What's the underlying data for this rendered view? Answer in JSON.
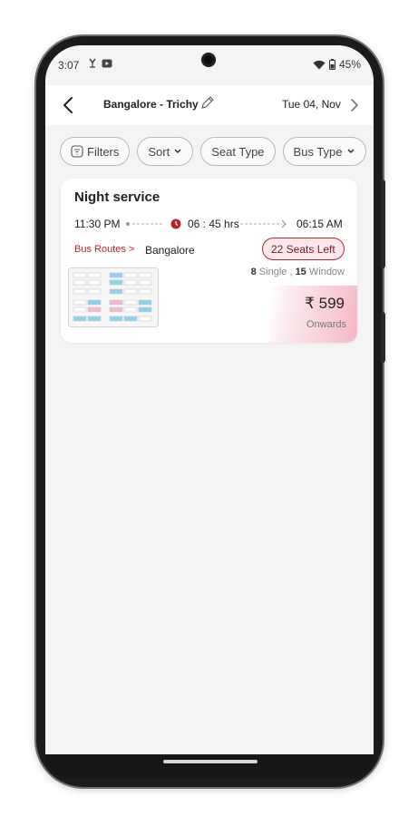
{
  "status_bar": {
    "time": "3:07",
    "battery": "45%"
  },
  "header": {
    "route": "Bangalore - Trichy",
    "date": "Tue 04, Nov"
  },
  "filters": [
    {
      "label": "Filters",
      "icon": "filter-icon"
    },
    {
      "label": "Sort",
      "icon": "chevron-down-icon"
    },
    {
      "label": "Seat Type"
    },
    {
      "label": "Bus Type",
      "icon": "chevron-down-icon"
    }
  ],
  "result": {
    "service_name": "Night service",
    "departure": "11:30 PM",
    "duration": "06 : 45 hrs",
    "arrival": "06:15 AM",
    "routes_link": "Bus Routes >",
    "origin": "Bangalore",
    "seats_left": "22 Seats Left",
    "single_count": "8",
    "single_label": "Single",
    "separator": ",",
    "window_count": "15",
    "window_label": "Window",
    "price": "₹ 599",
    "price_note": "Onwards"
  },
  "colors": {
    "accent": "#b3262e",
    "badge_bg": "#fde8ec",
    "seat_available": "#8fd0ee",
    "seat_ladies": "#f2b7cb"
  }
}
